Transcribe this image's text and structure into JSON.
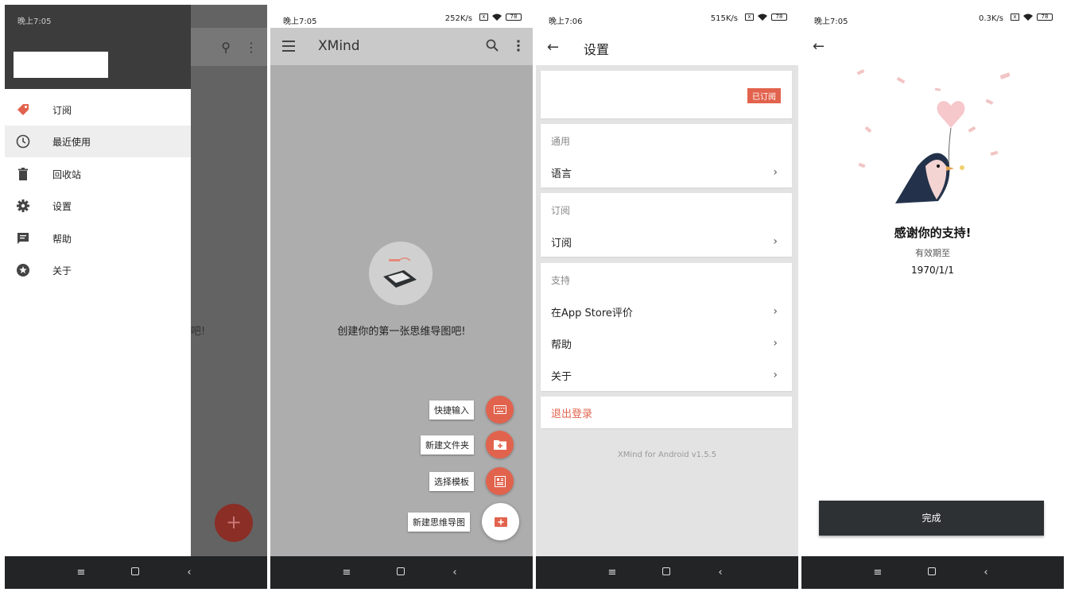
{
  "status_bar": {
    "screen1": {
      "time": "晚上7:05",
      "speed": "0.5K/s",
      "battery": "78"
    },
    "screen2": {
      "time": "晚上7:05",
      "speed": "252K/s",
      "battery": "78"
    },
    "screen3": {
      "time": "晚上7:06",
      "speed": "515K/s",
      "battery": "78"
    },
    "screen4": {
      "time": "晚上7:05",
      "speed": "0.3K/s",
      "battery": "78"
    }
  },
  "drawer": {
    "items": [
      {
        "label": "订阅",
        "icon": "tag-icon"
      },
      {
        "label": "最近使用",
        "icon": "clock-icon",
        "active": true
      },
      {
        "label": "回收站",
        "icon": "trash-icon"
      },
      {
        "label": "设置",
        "icon": "gear-icon"
      },
      {
        "label": "帮助",
        "icon": "chat-icon"
      },
      {
        "label": "关于",
        "icon": "star-icon"
      }
    ],
    "behind_text": "吧!"
  },
  "home": {
    "title": "XMind",
    "empty_text": "创建你的第一张思维导图吧!",
    "fab_menu": [
      {
        "label": "快捷输入",
        "icon": "keyboard-icon"
      },
      {
        "label": "新建文件夹",
        "icon": "folder-plus-icon"
      },
      {
        "label": "选择模板",
        "icon": "template-icon"
      },
      {
        "label": "新建思维导图",
        "icon": "map-plus-icon"
      }
    ]
  },
  "settings": {
    "title": "设置",
    "subscribed_badge": "已订阅",
    "sections": [
      {
        "header": "通用",
        "rows": [
          "语言"
        ]
      },
      {
        "header": "订阅",
        "rows": [
          "订阅"
        ]
      },
      {
        "header": "支持",
        "rows": [
          "在App Store评价",
          "帮助",
          "关于"
        ]
      }
    ],
    "logout": "退出登录",
    "version": "XMind for Android v1.5.5"
  },
  "thanks": {
    "title": "感谢你的支持!",
    "valid_label": "有效期至",
    "valid_date": "1970/1/1",
    "done_button": "完成"
  },
  "colors": {
    "accent": "#e2634d",
    "dark": "#2e3133"
  }
}
